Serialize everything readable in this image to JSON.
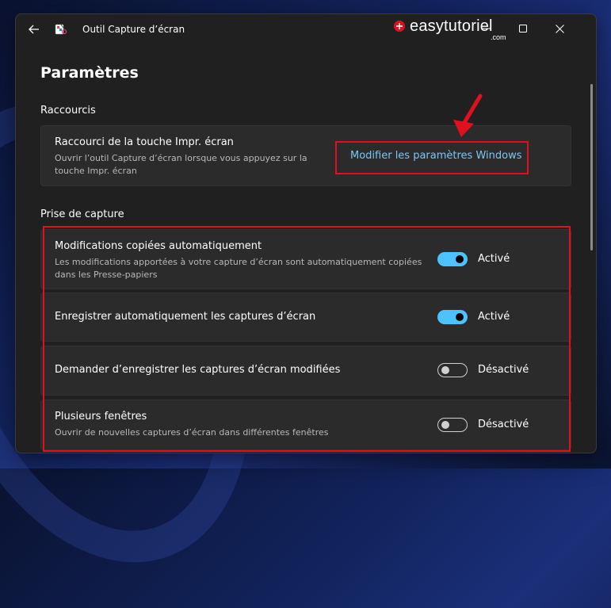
{
  "window": {
    "title": "Outil Capture d’écran",
    "logo_text": "easytutoriel",
    "logo_suffix": ".com"
  },
  "page": {
    "title": "Paramètres"
  },
  "shortcuts": {
    "section_title": "Raccourcis",
    "card_title": "Raccourci de la touche Impr. écran",
    "card_desc_line1": "Ouvrir l’outil Capture d’écran lorsque vous appuyez sur la",
    "card_desc_line2": "touche Impr. écran",
    "link_label": "Modifier les paramètres Windows"
  },
  "capture": {
    "section_title": "Prise de capture",
    "items": [
      {
        "title": "Modifications copiées automatiquement",
        "desc_line1": "Les modifications apportées à votre capture d’écran sont automatiquement copiées",
        "desc_line2": "dans les Presse-papiers",
        "state": "Activé",
        "on": true
      },
      {
        "title": "Enregistrer automatiquement les captures d’écran",
        "state": "Activé",
        "on": true
      },
      {
        "title": "Demander d’enregistrer les captures d’écran modifiées",
        "state": "Désactivé",
        "on": false
      },
      {
        "title": "Plusieurs fenêtres",
        "desc_line1": "Ouvrir de nouvelles captures d’écran dans différentes fenêtres",
        "state": "Désactivé",
        "on": false
      }
    ]
  },
  "colors": {
    "accent": "#4cc2ff",
    "link": "#7cc7f4",
    "annotation_red": "#e0101f"
  }
}
